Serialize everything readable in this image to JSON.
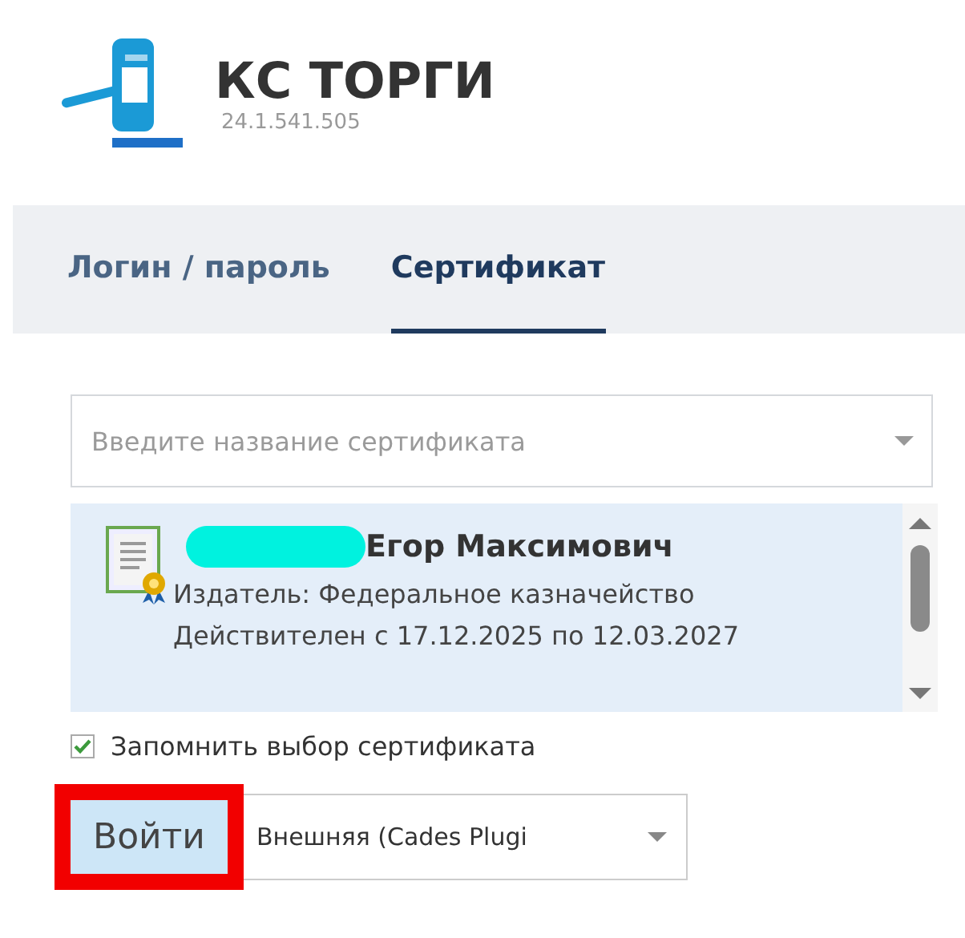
{
  "app": {
    "title": "КС ТОРГИ",
    "version": "24.1.541.505"
  },
  "tabs": [
    {
      "label": "Логин / пароль",
      "selected": false
    },
    {
      "label": "Сертификат",
      "selected": true
    }
  ],
  "certificate_search": {
    "placeholder": "Введите название сертификата"
  },
  "certificates": [
    {
      "name": "Егор Максимович",
      "redacted": true,
      "issuer": "Издатель: Федеральное казначейство",
      "validity": "Действителен с 17.12.2025 по 12.03.2027",
      "selected": true
    }
  ],
  "remember_choice": {
    "label": "Запомнить выбор сертификата",
    "checked": true
  },
  "login_button": {
    "label": "Войти",
    "highlighted": true
  },
  "signature_mode": {
    "value": "Внешняя (Cades Plugi"
  }
}
